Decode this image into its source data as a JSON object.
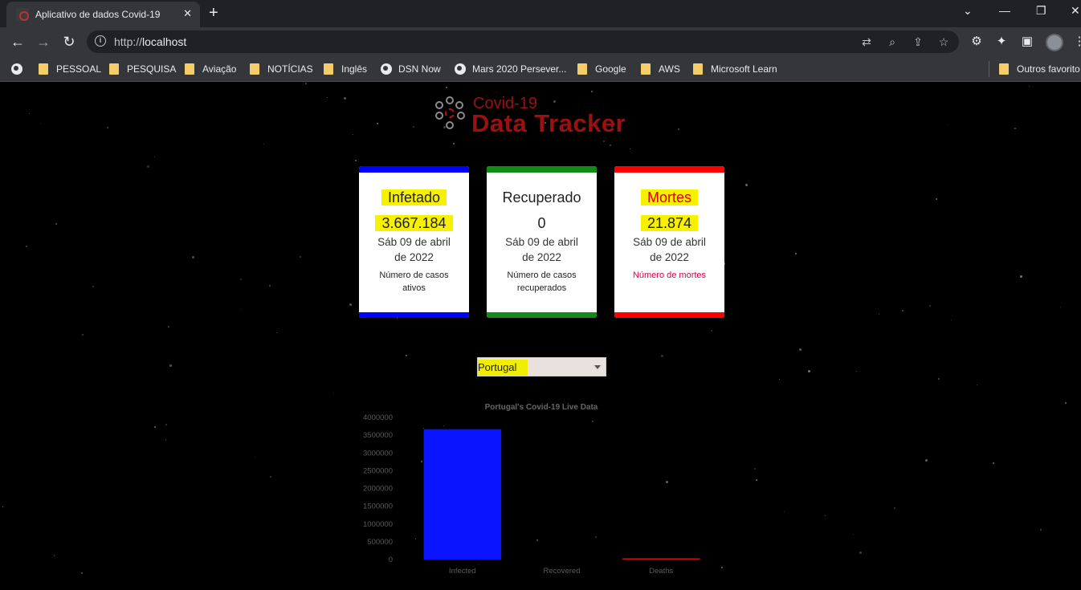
{
  "browser": {
    "tab_title": "Aplicativo de dados Covid-19",
    "tab_close": "✕",
    "new_tab": "+",
    "url_scheme": "http://",
    "url_host": "localhost",
    "window_controls": [
      "⌄",
      "—",
      "❐",
      "✕"
    ]
  },
  "bookmarks": [
    {
      "label": "",
      "icon": "globe-icon"
    },
    {
      "label": "PESSOAL",
      "icon": "folder-icon"
    },
    {
      "label": "PESQUISA",
      "icon": "folder-icon"
    },
    {
      "label": "Aviação",
      "icon": "folder-icon"
    },
    {
      "label": "NOTÍCIAS",
      "icon": "folder-icon"
    },
    {
      "label": "Inglês",
      "icon": "folder-icon"
    },
    {
      "label": "DSN Now",
      "icon": "globe-icon"
    },
    {
      "label": "Mars 2020 Persever...",
      "icon": "globe-icon"
    },
    {
      "label": "Google",
      "icon": "folder-icon"
    },
    {
      "label": "AWS",
      "icon": "folder-icon"
    },
    {
      "label": "Microsoft Learn",
      "icon": "folder-icon"
    },
    {
      "label": "Outros favorito",
      "icon": "folder-icon"
    }
  ],
  "logo": {
    "top": "Covid-19",
    "main": "Data Tracker"
  },
  "cards": {
    "infected": {
      "title": "Infetado",
      "value": "3.667.184",
      "date": "Sáb 09 de abril de 2022",
      "desc": "Número de casos ativos",
      "color": "#0000ff"
    },
    "recovered": {
      "title": "Recuperado",
      "value": "0",
      "date": "Sáb 09 de abril de 2022",
      "desc": "Número de casos recuperados",
      "color": "#138a13"
    },
    "deaths": {
      "title": "Mortes",
      "value": "21.874",
      "date": "Sáb 09 de abril de 2022",
      "desc": "Número de mortes",
      "color": "#ff0000"
    }
  },
  "country_select": {
    "selected": "Portugal"
  },
  "chart_data": {
    "type": "bar",
    "title": "Portugal's Covid-19 Live Data",
    "categories": [
      "Infected",
      "Recovered",
      "Deaths"
    ],
    "values": [
      3667184,
      0,
      21874
    ],
    "colors": [
      "#0a14ff",
      "#1a8a1a",
      "#c81010"
    ],
    "ylim": [
      0,
      4000000
    ],
    "yticks": [
      "0",
      "500000",
      "1000000",
      "1500000",
      "2000000",
      "2500000",
      "3000000",
      "3500000",
      "4000000"
    ],
    "grid": false,
    "legend": "none"
  }
}
